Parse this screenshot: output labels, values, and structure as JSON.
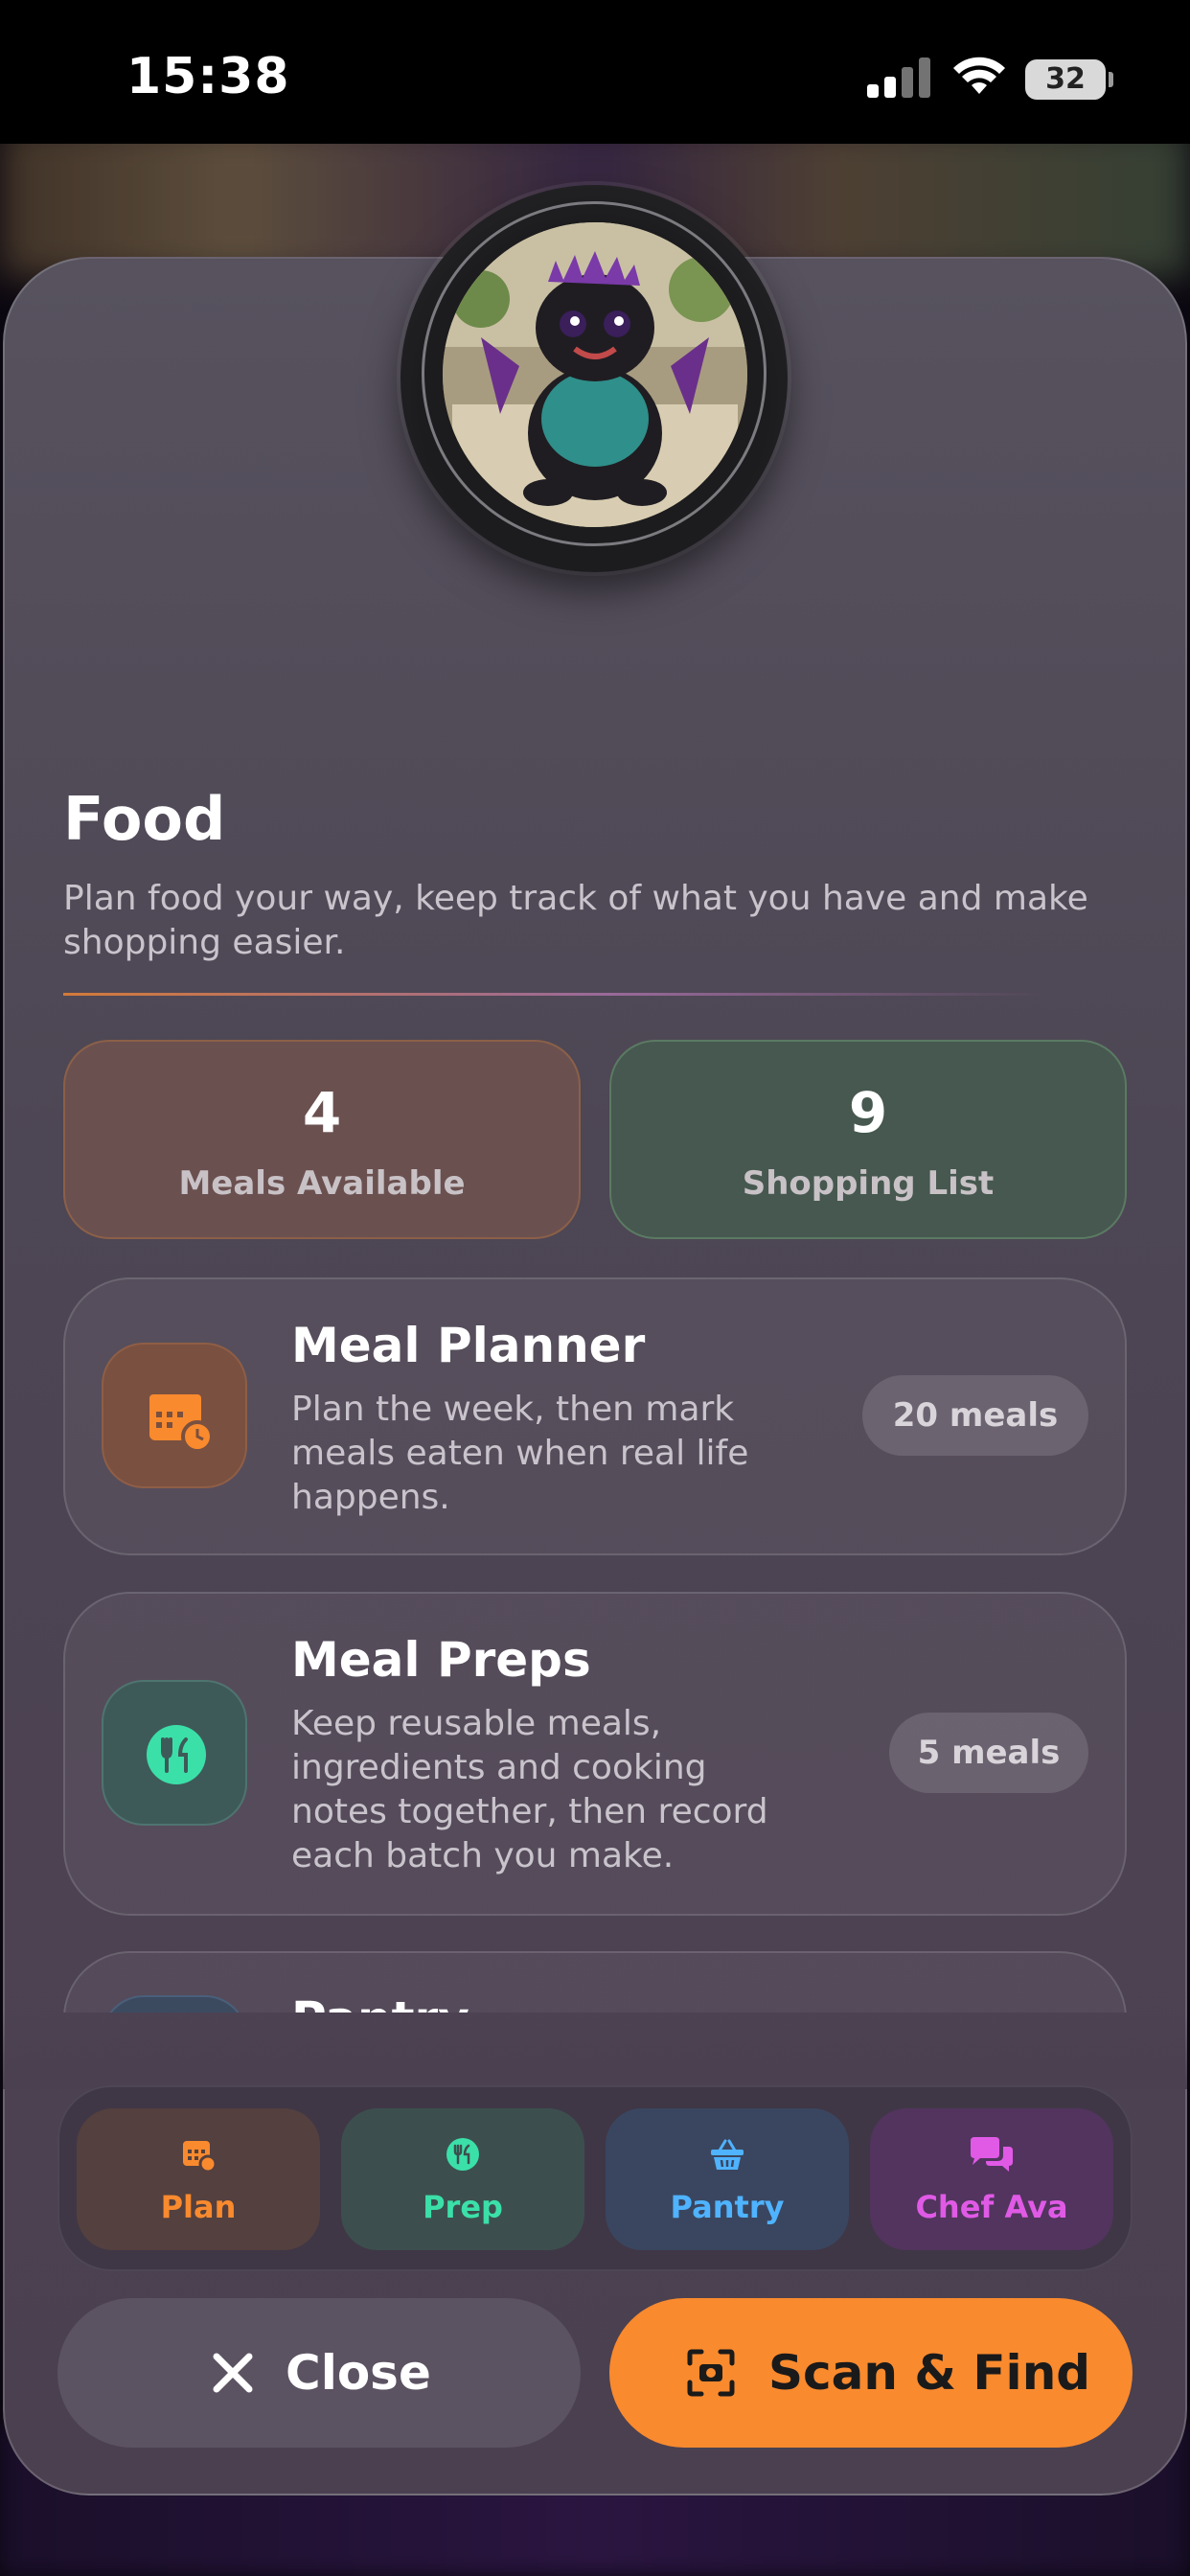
{
  "status_bar": {
    "time": "15:38",
    "battery": "32"
  },
  "header": {
    "title": "Food",
    "subtitle": "Plan food your way, keep track of what you have and make shopping easier."
  },
  "stats": [
    {
      "value": "4",
      "label": "Meals Available"
    },
    {
      "value": "9",
      "label": "Shopping List"
    }
  ],
  "features": [
    {
      "title": "Meal Planner",
      "description": "Plan the week, then mark meals eaten when real life happens.",
      "badge": "20 meals",
      "icon": "calendar-clock-icon"
    },
    {
      "title": "Meal Preps",
      "description": "Keep reusable meals, ingredients and cooking notes together, then record each batch you make.",
      "badge": "5 meals",
      "icon": "fork-knife-icon"
    },
    {
      "title": "Pantry",
      "icon": "basket-icon"
    }
  ],
  "tabs": [
    {
      "label": "Plan",
      "icon": "calendar-clock-icon",
      "color": "#f98a2e"
    },
    {
      "label": "Prep",
      "icon": "fork-knife-icon",
      "color": "#3be0a8"
    },
    {
      "label": "Pantry",
      "icon": "basket-icon",
      "color": "#4fb3ff"
    },
    {
      "label": "Chef Ava",
      "icon": "chat-bubbles-icon",
      "color": "#e05ae6"
    }
  ],
  "actions": {
    "close_label": "Close",
    "scan_label": "Scan & Find"
  },
  "colors": {
    "accent_orange": "#f98a2e",
    "accent_green": "#3be0a8",
    "accent_blue": "#4fb3ff",
    "accent_purple": "#e05ae6"
  }
}
